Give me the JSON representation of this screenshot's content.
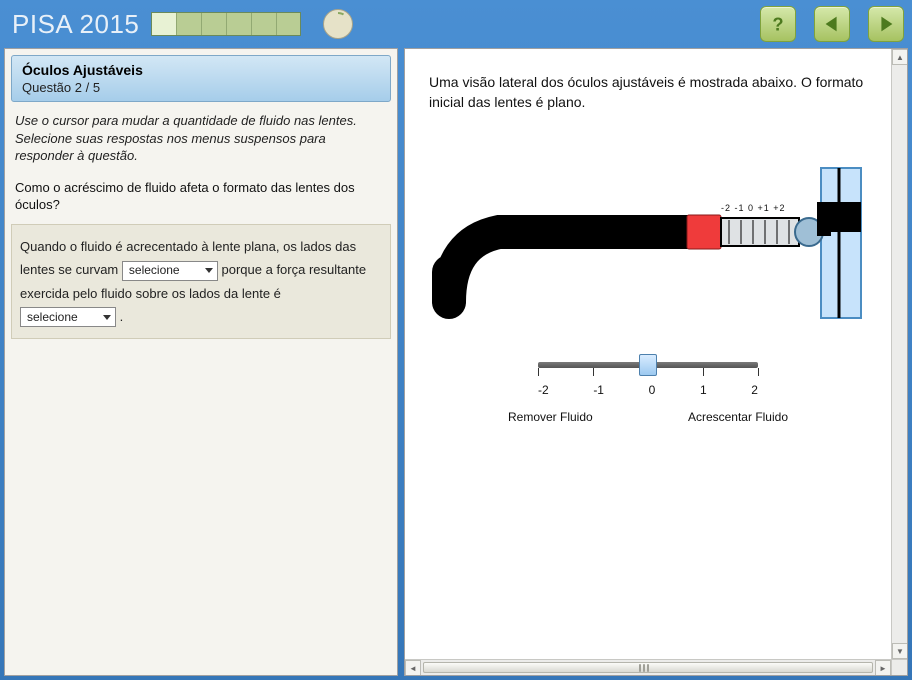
{
  "brand": "PISA 2015",
  "progress": {
    "total": 6,
    "completed": 1
  },
  "header": {
    "help_icon": "question-mark",
    "prev_icon": "triangle-left",
    "next_icon": "triangle-right"
  },
  "left": {
    "title": "Óculos Ajustáveis",
    "subtitle": "Questão 2 / 5",
    "instructions": "Use o cursor para mudar a quantidade de fluido nas lentes. Selecione suas respostas nos menus suspensos para responder à questão.",
    "question": "Como o acréscimo de fluido afeta o formato das lentes dos óculos?",
    "answer": {
      "part1": "Quando o fluido é acrecentado à lente plana, os lados das lentes se curvam",
      "part2": "porque a força resultante exercida pelo fluido sobre os lados da lente é",
      "select_placeholder": "selecione",
      "trailing": "."
    }
  },
  "right": {
    "description": "Uma visão lateral dos óculos ajustáveis é mostrada abaixo. O formato inicial das lentes é plano.",
    "syringe_scale": "-2 -1  0 +1 +2",
    "slider": {
      "min": -2,
      "max": 2,
      "value": 0,
      "ticks": [
        "-2",
        "-1",
        "0",
        "1",
        "2"
      ],
      "caption_left": "Remover Fluido",
      "caption_right": "Acrescentar Fluido"
    }
  }
}
